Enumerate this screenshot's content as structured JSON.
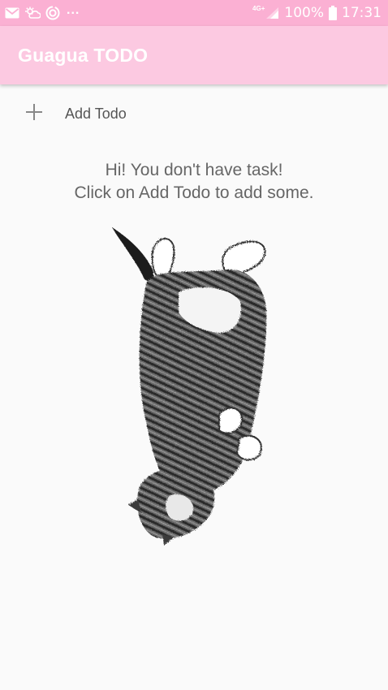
{
  "status_bar": {
    "icons_left": [
      "mail-icon",
      "weather-icon",
      "sync-icon"
    ],
    "overflow": "...",
    "network_label": "4G+",
    "battery": "100%",
    "time": "17:31"
  },
  "app_bar": {
    "title": "Guagua TODO"
  },
  "add_todo": {
    "label": "Add Todo",
    "icon": "plus-icon"
  },
  "empty_state": {
    "line1": "Hi! You don't have task!",
    "line2": "Click on Add Todo to add some.",
    "illustration": "sleeping-cat-illustration"
  },
  "colors": {
    "status_bar": "#fbb0d3",
    "app_bar": "#fcc9e1",
    "background": "#fafafa",
    "text": "#666666"
  }
}
